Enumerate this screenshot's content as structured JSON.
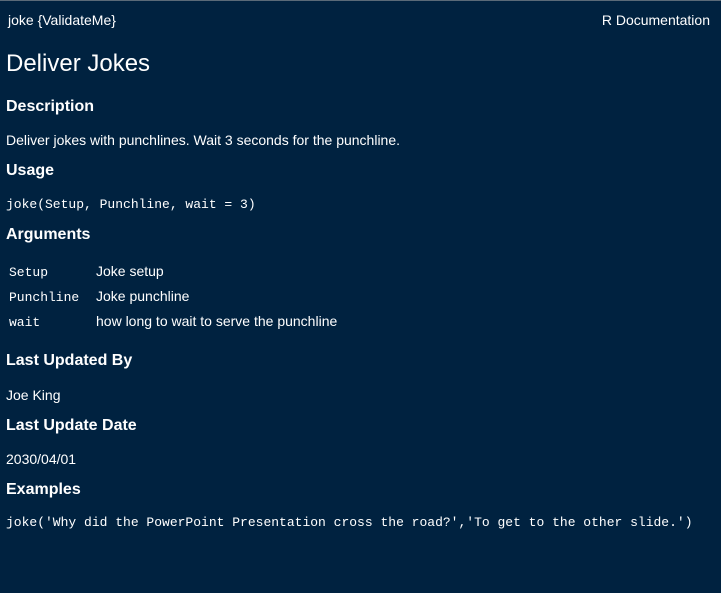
{
  "header": {
    "left": "joke {ValidateMe}",
    "right": "R Documentation"
  },
  "title": "Deliver Jokes",
  "sections": {
    "description_heading": "Description",
    "description_text": "Deliver jokes with punchlines. Wait 3 seconds for the punchline.",
    "usage_heading": "Usage",
    "usage_code": "joke(Setup, Punchline, wait = 3)",
    "arguments_heading": "Arguments",
    "arguments": [
      {
        "name": "Setup",
        "desc": "Joke setup"
      },
      {
        "name": "Punchline",
        "desc": "Joke punchline"
      },
      {
        "name": "wait",
        "desc": "how long to wait to serve the punchline"
      }
    ],
    "updated_by_heading": "Last Updated By",
    "updated_by": "Joe King",
    "update_date_heading": "Last Update Date",
    "update_date": "2030/04/01",
    "examples_heading": "Examples",
    "examples_code": "joke('Why did the PowerPoint Presentation cross the road?','To get to the other slide.')"
  }
}
